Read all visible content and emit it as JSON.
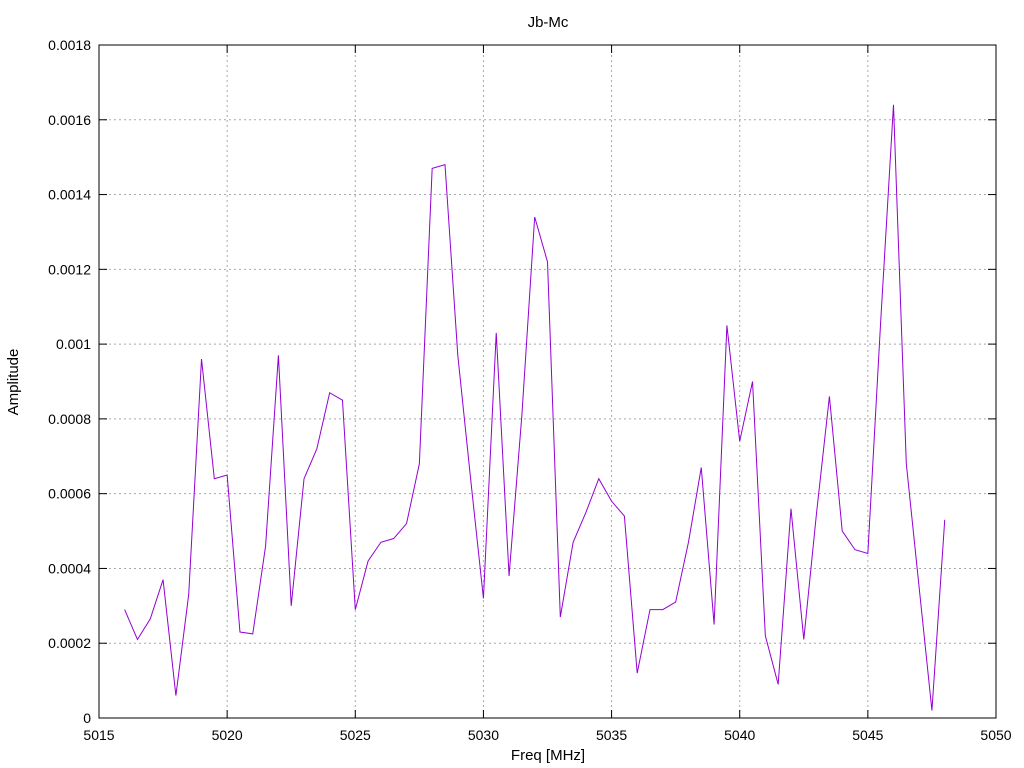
{
  "chart_data": {
    "type": "line",
    "title": "Jb-Mc",
    "xlabel": "Freq [MHz]",
    "ylabel": "Amplitude",
    "xlim": [
      5015,
      5050
    ],
    "ylim": [
      0,
      0.0018
    ],
    "x_ticks": [
      5015,
      5020,
      5025,
      5030,
      5035,
      5040,
      5045,
      5050
    ],
    "y_ticks": [
      0,
      0.0002,
      0.0004,
      0.0006,
      0.0008,
      0.001,
      0.0012,
      0.0014,
      0.0016,
      0.0018
    ],
    "x_tick_labels": [
      "5015",
      "5020",
      "5025",
      "5030",
      "5035",
      "5040",
      "5045",
      "5050"
    ],
    "y_tick_labels": [
      "0",
      "0.0002",
      "0.0004",
      "0.0006",
      "0.0008",
      "0.001",
      "0.0012",
      "0.0014",
      "0.0016",
      "0.0018"
    ],
    "grid": true,
    "line_color": "#9400d3",
    "series": [
      {
        "x": [
          5016,
          5016.5,
          5017,
          5017.5,
          5018,
          5018.5,
          5019,
          5019.5,
          5020,
          5020.5,
          5021,
          5021.5,
          5022,
          5022.5,
          5023,
          5023.5,
          5024,
          5024.5,
          5025,
          5025.5,
          5026,
          5026.5,
          5027,
          5027.5,
          5028,
          5028.5,
          5029,
          5029.5,
          5030,
          5030.5,
          5031,
          5031.5,
          5032,
          5032.5,
          5033,
          5033.5,
          5034,
          5034.5,
          5035,
          5035.5,
          5036,
          5036.5,
          5037,
          5037.5,
          5038,
          5038.5,
          5039,
          5039.5,
          5040,
          5040.5,
          5041,
          5041.5,
          5042,
          5042.5,
          5043,
          5043.5,
          5044,
          5044.5,
          5045,
          5045.5,
          5046,
          5046.5,
          5047,
          5047.5,
          5048
        ],
        "values": [
          0.00029,
          0.00021,
          0.000265,
          0.00037,
          6e-05,
          0.00033,
          0.00096,
          0.00064,
          0.00065,
          0.00023,
          0.000225,
          0.00046,
          0.00097,
          0.0003,
          0.00064,
          0.00072,
          0.00087,
          0.00085,
          0.00029,
          0.00042,
          0.00047,
          0.00048,
          0.00052,
          0.00068,
          0.00147,
          0.00148,
          0.00097,
          0.00064,
          0.00032,
          0.00103,
          0.00038,
          0.00081,
          0.00134,
          0.00122,
          0.00027,
          0.00047,
          0.00055,
          0.00064,
          0.00058,
          0.00054,
          0.00012,
          0.00029,
          0.00029,
          0.00031,
          0.00047,
          0.00067,
          0.00025,
          0.00105,
          0.00074,
          0.0009,
          0.00022,
          9e-05,
          0.00056,
          0.00021,
          0.00055,
          0.00086,
          0.0005,
          0.00045,
          0.00044,
          0.00106,
          0.00164,
          0.00068,
          0.00035,
          2e-05,
          0.00053
        ]
      }
    ]
  }
}
